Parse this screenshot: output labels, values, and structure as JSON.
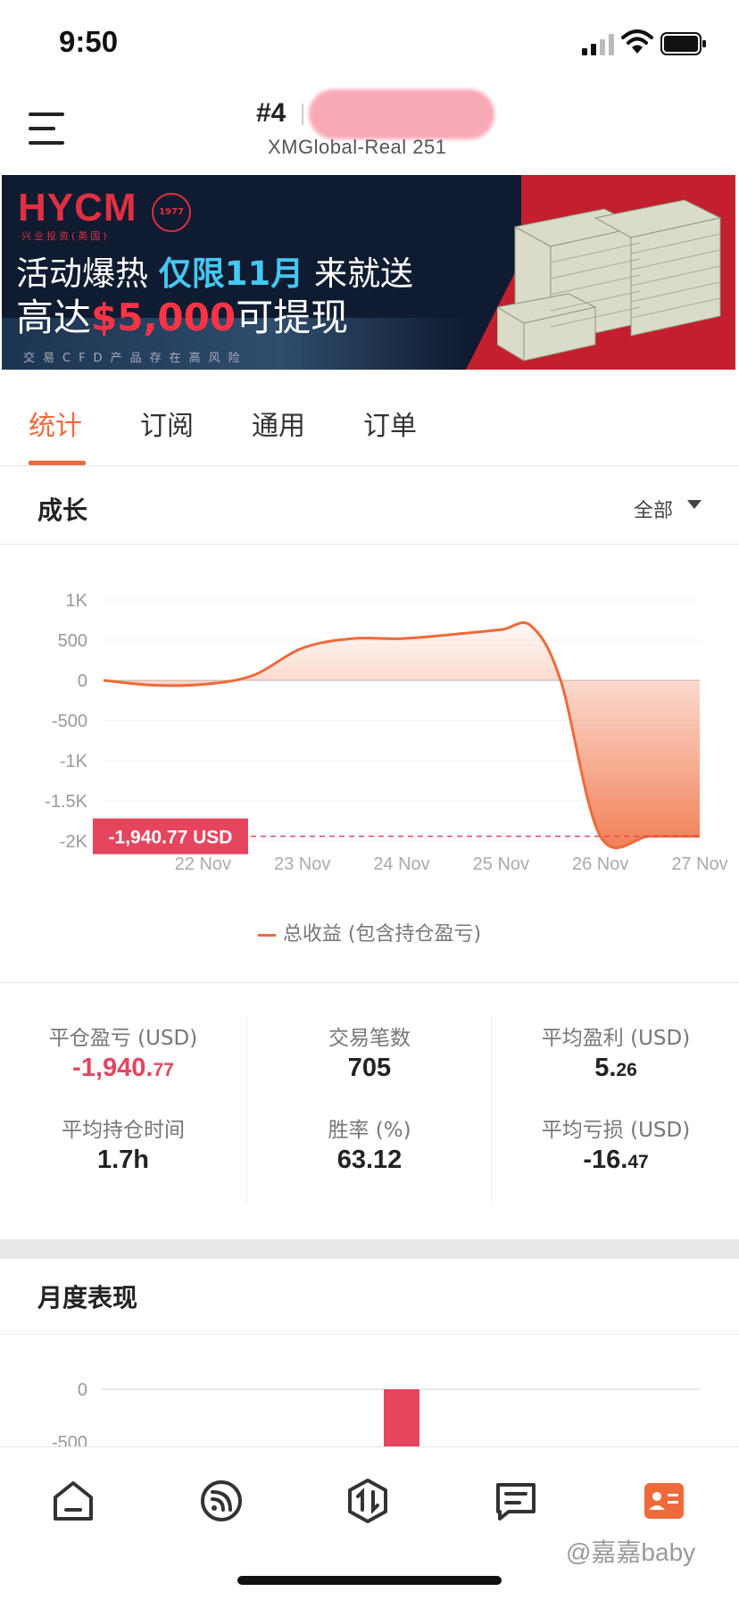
{
  "status_bar": {
    "time": "9:50"
  },
  "header": {
    "account_rank": "#4",
    "account_server": "XMGlobal-Real 251"
  },
  "banner": {
    "brand": "HYCM",
    "brand_sub": "兴业投资(英国)",
    "seal_text": "1977",
    "line1_a": "活动爆热 ",
    "line1_hi": "仅限11月",
    "line1_b": " 来就送",
    "line2_a": "高达",
    "line2_amount": "$5,000",
    "line2_b": "可提现",
    "risk": "交易CFD产品存在高风险"
  },
  "tabs": [
    {
      "label": "统计",
      "active": true
    },
    {
      "label": "订阅",
      "active": false
    },
    {
      "label": "通用",
      "active": false
    },
    {
      "label": "订单",
      "active": false
    }
  ],
  "growth": {
    "title": "成长",
    "filter": "全部"
  },
  "chart_data": {
    "type": "area",
    "x": [
      "21 Nov",
      "21.5 Nov",
      "22 Nov",
      "22.5 Nov",
      "23 Nov",
      "23.5 Nov",
      "24 Nov",
      "24.5 Nov",
      "25 Nov",
      "25.3 Nov",
      "25.6 Nov",
      "26 Nov",
      "26.5 Nov",
      "27 Nov"
    ],
    "x_ticks": [
      "22 Nov",
      "23 Nov",
      "24 Nov",
      "25 Nov",
      "26 Nov",
      "27 Nov"
    ],
    "y_ticks": [
      "1K",
      "500",
      "0",
      "-500",
      "-1K",
      "-1.5K",
      "-2K"
    ],
    "ylim": [
      -2000,
      1000
    ],
    "series": [
      {
        "name": "总收益 (包含持仓盈亏)",
        "color": "#ef6a3a",
        "values": [
          0,
          -60,
          -50,
          60,
          400,
          520,
          520,
          570,
          630,
          680,
          0,
          -1940.77,
          -1940.77,
          -1940.77
        ]
      }
    ],
    "current_label": "-1,940.77 USD",
    "current_value": -1940.77,
    "legend": "总收益 (包含持仓盈亏)"
  },
  "stats": [
    {
      "label": "平仓盈亏 (USD)",
      "value_main": "-1,940.",
      "value_small": "77",
      "negative": true
    },
    {
      "label": "交易笔数",
      "value_main": "705",
      "value_small": ""
    },
    {
      "label": "平均盈利 (USD)",
      "value_main": "5.",
      "value_small": "26"
    },
    {
      "label": "平均持仓时间",
      "value_main": "1.7h",
      "value_small": ""
    },
    {
      "label": "胜率 (%)",
      "value_main": "63.12",
      "value_small": ""
    },
    {
      "label": "平均亏损 (USD)",
      "value_main": "-16.",
      "value_small": "47"
    }
  ],
  "monthly": {
    "title": "月度表现",
    "y_ticks": [
      "0",
      "-500"
    ]
  },
  "nav": [
    {
      "name": "home",
      "active": false
    },
    {
      "name": "feed",
      "active": false
    },
    {
      "name": "trade",
      "active": false
    },
    {
      "name": "messages",
      "active": false
    },
    {
      "name": "profile",
      "active": true
    }
  ],
  "watermark": "@嘉嘉baby",
  "colors": {
    "accent": "#ef6a3a",
    "negative": "#e5455d",
    "label_bg": "#e5455d"
  }
}
